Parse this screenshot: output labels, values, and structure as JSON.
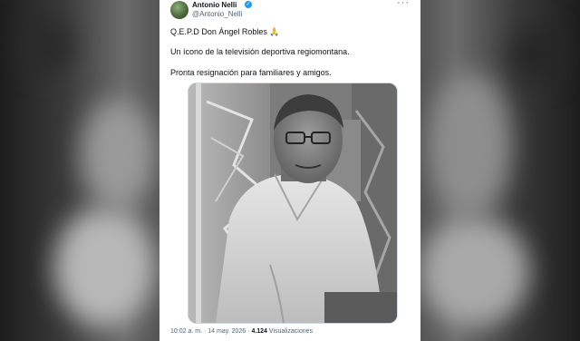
{
  "tweet": {
    "author_name": "Antonio Nelli",
    "author_handle": "@Antonio_Nelli",
    "verified_mark": "✓",
    "more_menu": "···",
    "lines": [
      "Q.E.P.D Don Ángel Robles 🙏",
      "Un ícono de la televisión deportiva regiomontana.",
      "Pronta resignación para familiares y amigos."
    ],
    "time": "10:02 a. m.",
    "separator": "·",
    "date": "14 may. 2026",
    "views_count": "4.124",
    "views_label": "Visualizaciones"
  },
  "colors": {
    "verified_badge": "#1d9bf0",
    "text_primary": "#0f1419",
    "text_secondary": "#536471"
  },
  "icons": {
    "verified": "verified-badge-icon",
    "more": "more-options-icon"
  }
}
